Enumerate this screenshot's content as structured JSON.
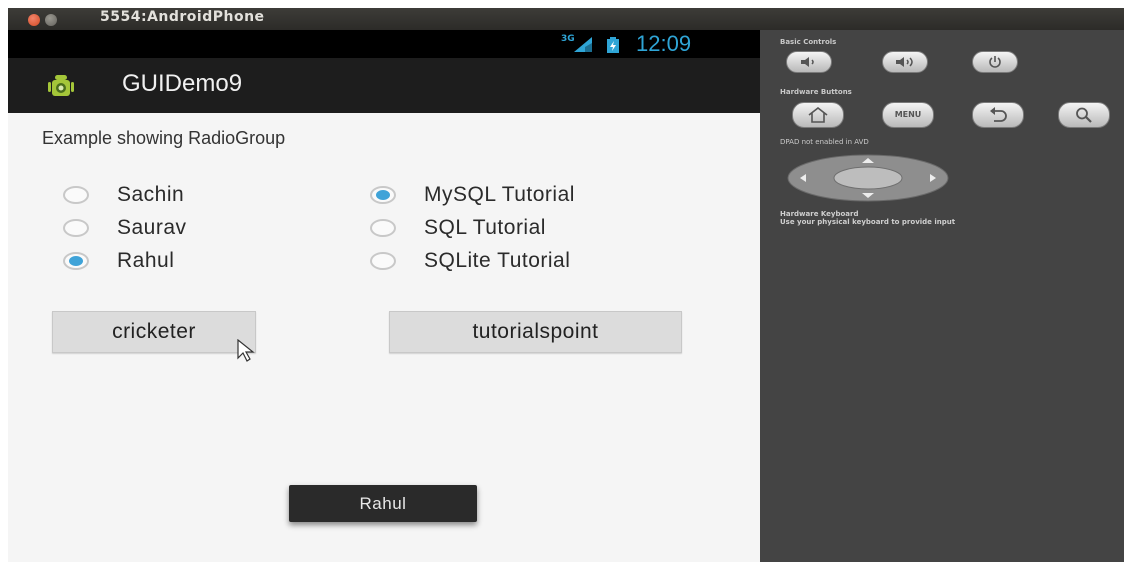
{
  "window": {
    "title": "5554:AndroidPhone"
  },
  "status_bar": {
    "network": "3G",
    "time": "12:09"
  },
  "action_bar": {
    "title": "GUIDemo9"
  },
  "content": {
    "heading": "Example showing RadioGroup",
    "group1": [
      {
        "label": "Sachin",
        "checked": false
      },
      {
        "label": "Saurav",
        "checked": false
      },
      {
        "label": "Rahul",
        "checked": true
      }
    ],
    "group2": [
      {
        "label": "MySQL Tutorial",
        "checked": true
      },
      {
        "label": "SQL Tutorial",
        "checked": false
      },
      {
        "label": "SQLite Tutorial",
        "checked": false
      }
    ],
    "button1": "cricketer",
    "button2": "tutorialspoint",
    "toast": "Rahul"
  },
  "controls": {
    "basic_label": "Basic Controls",
    "hardware_label": "Hardware Buttons",
    "menu_label": "MENU",
    "dpad_label": "DPAD not enabled in AVD",
    "keyboard_label": "Hardware Keyboard",
    "keyboard_hint": "Use your physical keyboard to provide input"
  },
  "colors": {
    "accent": "#3fa3d8",
    "actionbar": "#1d1d1d",
    "panel": "#444444"
  }
}
